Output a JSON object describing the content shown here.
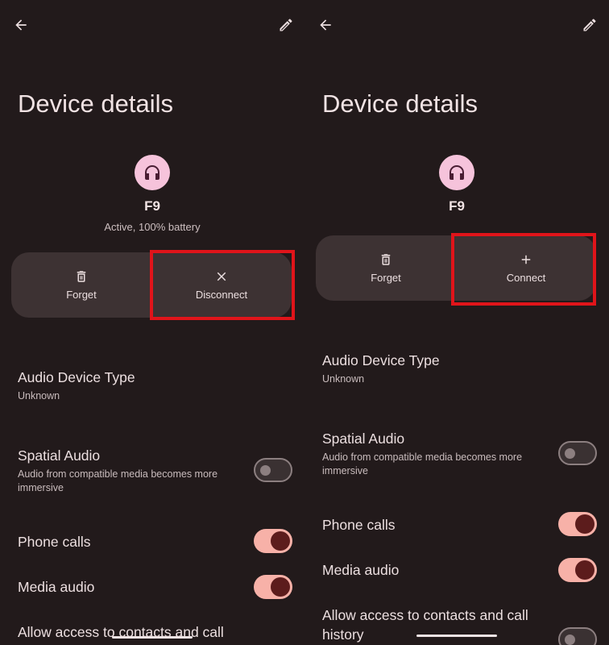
{
  "colors": {
    "background": "#221a1b",
    "highlight": "#e0141a",
    "toggle_on": "#f7b1a8",
    "avatar": "#f6c3db"
  },
  "icons": {
    "back": "arrow-left-icon",
    "edit": "pencil-icon",
    "device": "headset-icon",
    "forget": "trash-icon",
    "disconnect": "close-icon",
    "connect": "plus-icon"
  },
  "left": {
    "title": "Device details",
    "device_name": "F9",
    "status": "Active, 100% battery",
    "forget_label": "Forget",
    "primary_label": "Disconnect",
    "audio_type_title": "Audio Device Type",
    "audio_type_value": "Unknown",
    "spatial_title": "Spatial Audio",
    "spatial_sub_1": "Audio from compatible media becomes more",
    "spatial_sub_2": "immersive",
    "spatial_on": false,
    "phone_calls": "Phone calls",
    "phone_calls_on": true,
    "media_audio": "Media audio",
    "media_audio_on": true,
    "contacts": "Allow access to contacts and call"
  },
  "right": {
    "title": "Device details",
    "device_name": "F9",
    "forget_label": "Forget",
    "primary_label": "Connect",
    "audio_type_title": "Audio Device Type",
    "audio_type_value": "Unknown",
    "spatial_title": "Spatial Audio",
    "spatial_sub_1": "Audio from compatible media becomes more",
    "spatial_sub_2": "immersive",
    "spatial_on": false,
    "phone_calls": "Phone calls",
    "phone_calls_on": true,
    "media_audio": "Media audio",
    "media_audio_on": true,
    "contacts_1": "Allow access to contacts and call",
    "contacts_2": "history",
    "contacts_on": false
  }
}
